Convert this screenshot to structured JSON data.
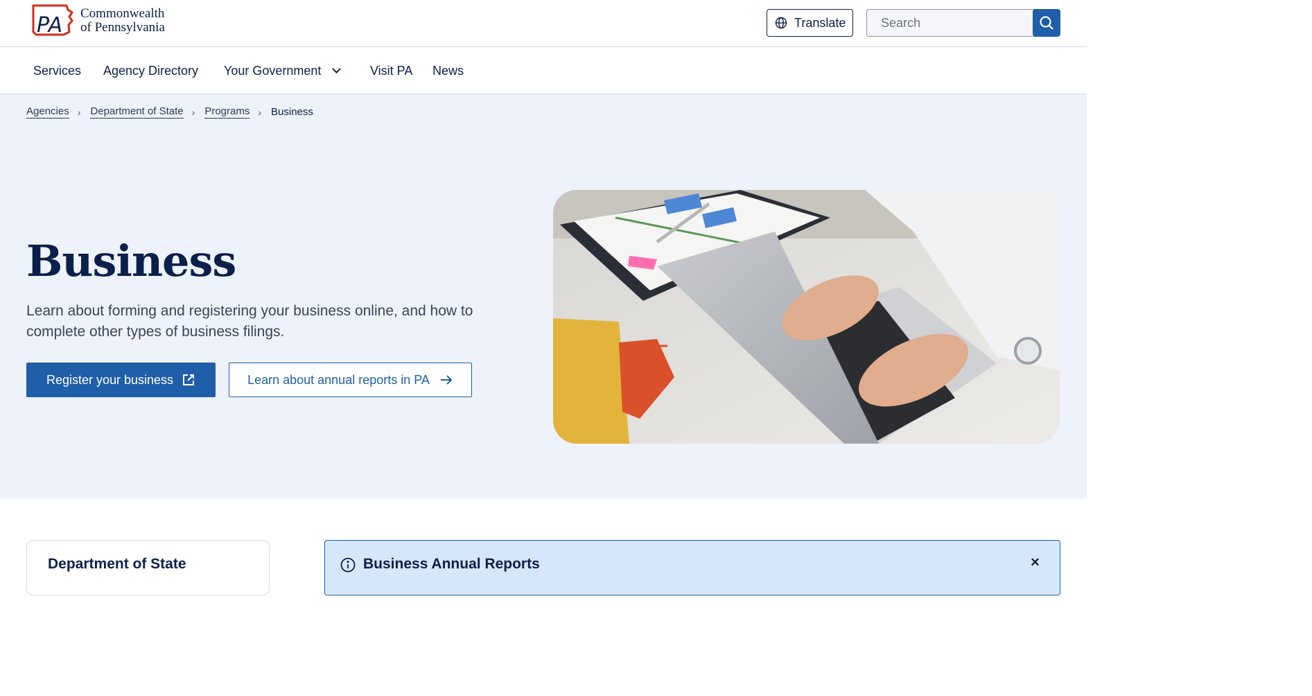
{
  "header": {
    "logo_line1": "Commonwealth",
    "logo_line2": "of Pennsylvania",
    "logo_mark": "PA",
    "translate_label": "Translate",
    "search_placeholder": "Search"
  },
  "nav": {
    "items": [
      {
        "label": "Services"
      },
      {
        "label": "Agency Directory"
      },
      {
        "label": "Your Government"
      },
      {
        "label": "Visit PA"
      },
      {
        "label": "News"
      }
    ]
  },
  "breadcrumb": {
    "items": [
      "Agencies",
      "Department of State",
      "Programs"
    ],
    "current": "Business"
  },
  "hero": {
    "title": "Business",
    "description": "Learn about forming and registering your business online, and how to complete other types of business filings.",
    "primary_button": "Register your business",
    "secondary_button": "Learn about annual reports in PA"
  },
  "sidebar": {
    "title": "Department of State"
  },
  "alert": {
    "title": "Business Annual Reports",
    "close": "×"
  },
  "colors": {
    "primary": "#1f5ea8",
    "navy": "#0b1f4b",
    "hero_bg": "#eef2fa",
    "alert_bg": "#d6e7fb",
    "logo_red": "#d52b1e"
  },
  "icons": [
    "pa-logo-icon",
    "globe-icon",
    "search-icon",
    "chevron-down-icon",
    "chevron-right-icon",
    "external-link-icon",
    "arrow-right-icon",
    "info-icon",
    "close-icon"
  ]
}
